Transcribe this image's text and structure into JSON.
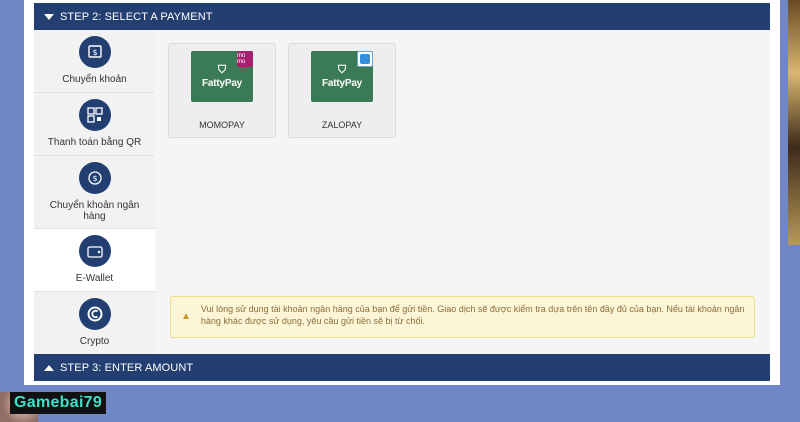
{
  "step2": {
    "label": "STEP 2: SELECT A PAYMENT"
  },
  "step3": {
    "label": "STEP 3: ENTER AMOUNT"
  },
  "sidebar": {
    "items": [
      {
        "label": "Chuyển khoản",
        "icon": "bank-transfer-icon"
      },
      {
        "label": "Thanh toán bằng QR",
        "icon": "qr-code-icon"
      },
      {
        "label": "Chuyển khoản ngân hàng",
        "icon": "bank-exchange-icon"
      },
      {
        "label": "E-Wallet",
        "icon": "wallet-icon",
        "active": true
      },
      {
        "label": "Crypto",
        "icon": "crypto-icon"
      }
    ]
  },
  "wallets": [
    {
      "name": "MOMOPAY",
      "logo_text": "FattyPay",
      "badge": "mo mo"
    },
    {
      "name": "ZALOPAY",
      "logo_text": "FattyPay"
    }
  ],
  "notice": {
    "text": "Vui lòng sử dụng tài khoản ngân hàng của bạn để gửi tiền. Giao dịch sẽ được kiểm tra dựa trên tên đầy đủ của bạn. Nếu tài khoản ngân hàng khác được sử dụng, yêu cầu gửi tiền sẽ bị từ chối."
  },
  "brand": {
    "text": "Gamebai79"
  },
  "colors": {
    "header": "#233f72",
    "background": "#6f87c6",
    "logo_green": "#3a7a55"
  }
}
